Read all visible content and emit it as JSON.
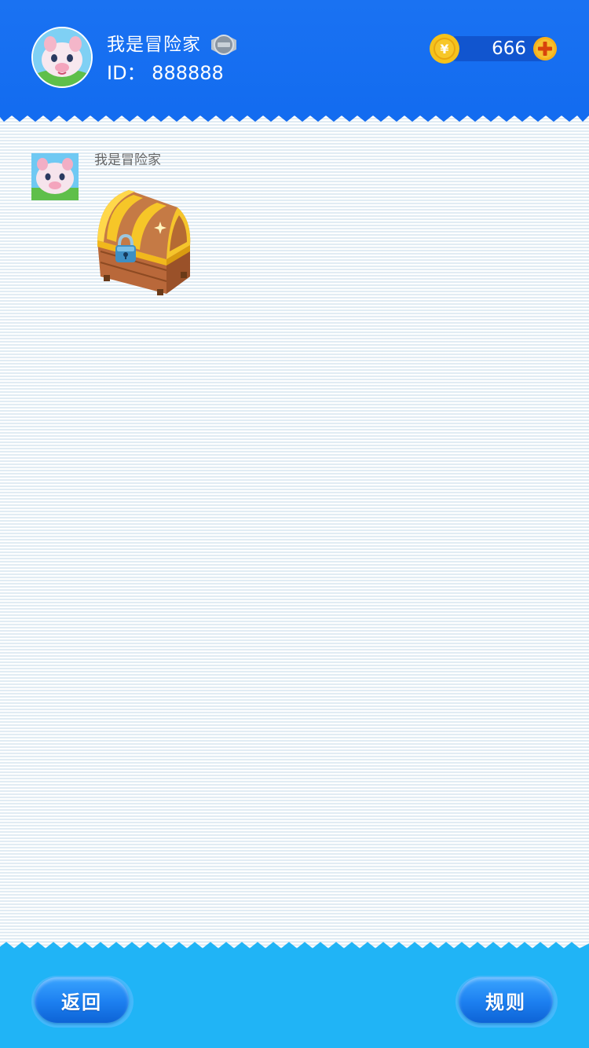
{
  "header": {
    "user_name": "我是冒险家",
    "user_id": "ID： 888888",
    "coins": "666"
  },
  "message": {
    "sender": "我是冒险家",
    "item": "treasure-chest"
  },
  "footer": {
    "back_label": "返回",
    "rules_label": "规则"
  },
  "colors": {
    "header_bg": "#136cf0",
    "footer_bg": "#20b4f6",
    "coin_bar": "#1155cf",
    "coin_gold": "#f5c21b",
    "button_blue": "#1c7ff0"
  },
  "icons": [
    "avatar",
    "vip-badge-icon",
    "coin-icon",
    "plus-icon",
    "treasure-chest-icon"
  ]
}
